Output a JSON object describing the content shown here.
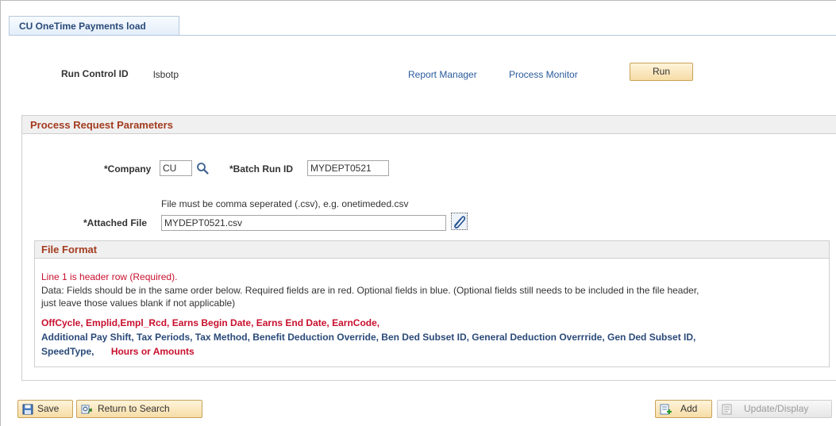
{
  "tab": {
    "label": "CU OneTime Payments load"
  },
  "run_control": {
    "label": "Run Control ID",
    "value": "lsbotp"
  },
  "header_links": {
    "report_manager": "Report Manager",
    "process_monitor": "Process Monitor",
    "run": "Run"
  },
  "params": {
    "title": "Process Request Parameters",
    "company_label": "*Company",
    "company_value": "CU",
    "batch_label": "*Batch Run ID",
    "batch_value": "MYDEPT0521",
    "hint": "File must be comma seperated (.csv), e.g. onetimeded.csv",
    "file_label": "*Attached File",
    "file_value": "MYDEPT0521.csv"
  },
  "file_format": {
    "title": "File Format",
    "line1": "Line 1 is header row (Required).",
    "data_line1": "Data: Fields should be in the same order below. Required fields are in red. Optional fields in blue. (Optional fields still needs to be included in the file header,",
    "data_line2": "just leave those values blank if not applicable)",
    "fields_row1": "OffCycle, Emplid,Empl_Rcd, Earns Begin Date, Earns End Date, EarnCode,",
    "fields_row2": "Additional Pay Shift, Tax Periods, Tax Method, Benefit Deduction Override, Ben Ded Subset ID, General Deduction Overrride, Gen Ded Subset ID,",
    "fields_row3_blue": "SpeedType,",
    "fields_row3_red": "Hours or Amounts"
  },
  "toolbar": {
    "save": "Save",
    "return": "Return to Search",
    "add": "Add",
    "update": "Update/Display"
  },
  "icons": {
    "lookup": "magnifier-icon",
    "attach": "paperclip-icon",
    "save": "floppy-disk-icon",
    "return": "return-arrow-icon",
    "add": "add-document-icon",
    "update": "update-display-icon"
  }
}
